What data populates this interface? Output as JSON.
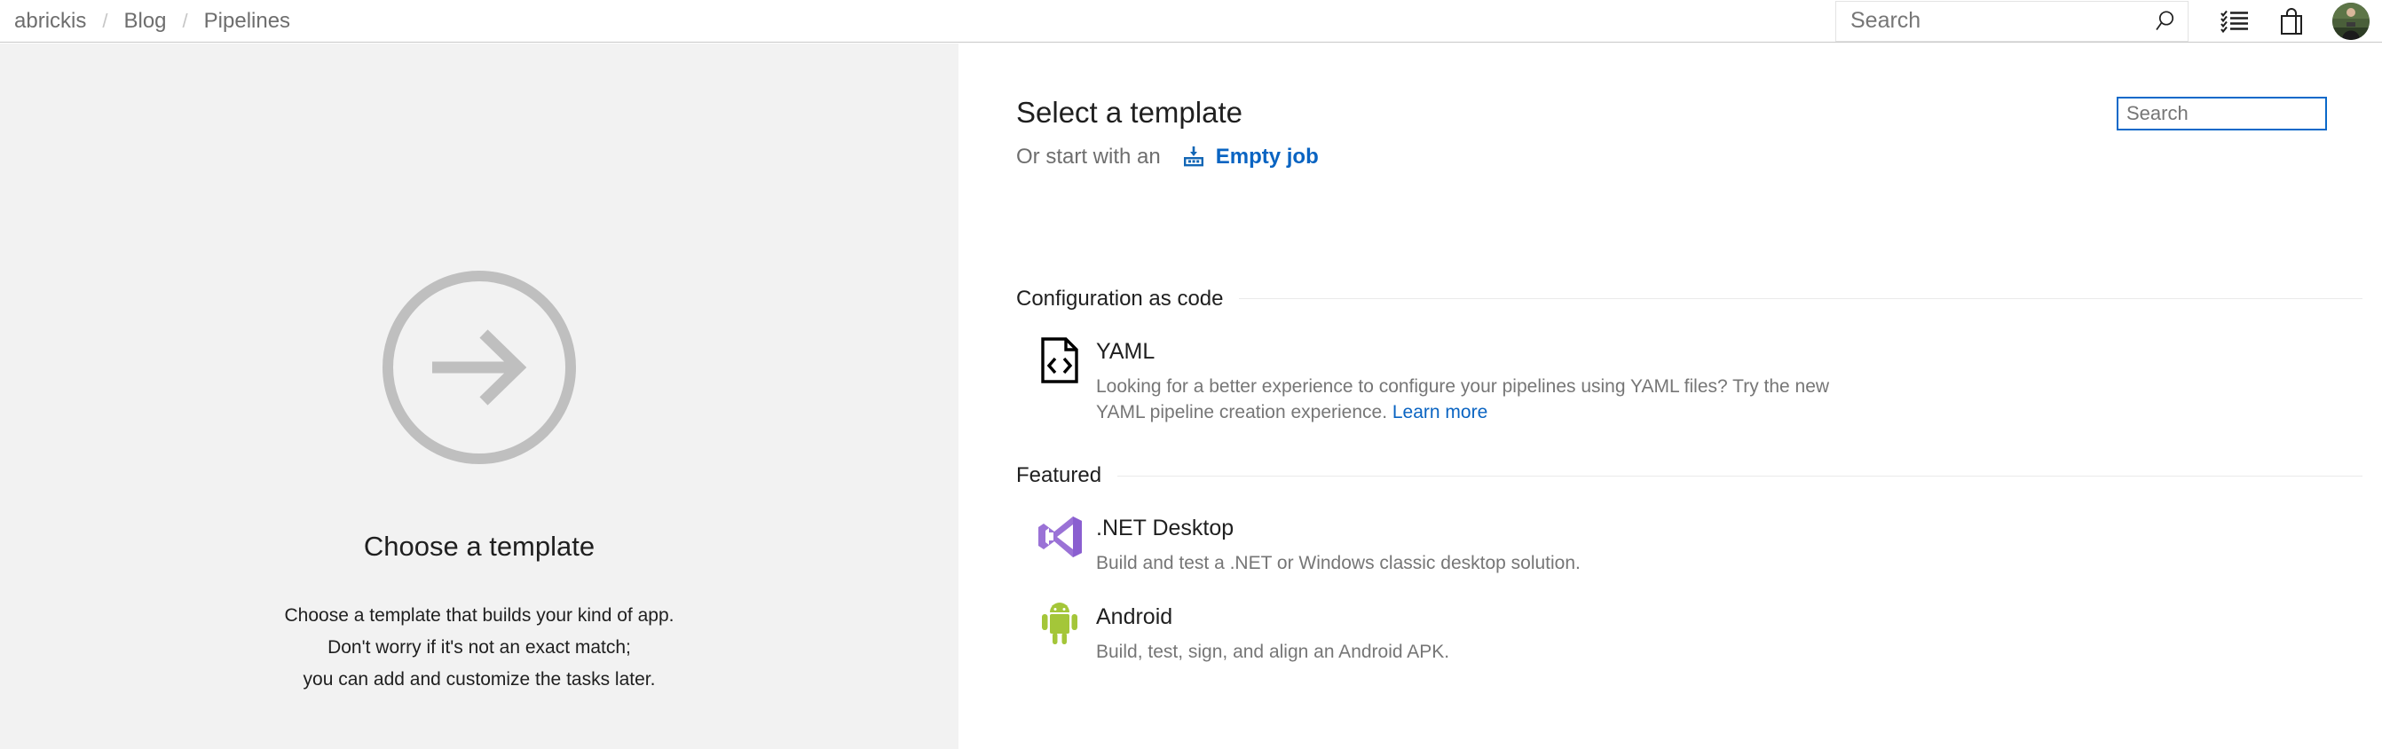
{
  "header": {
    "breadcrumb": {
      "items": [
        "abrickis",
        "Blog",
        "Pipelines"
      ],
      "separator": "/"
    },
    "search": {
      "placeholder": "Search",
      "value": "",
      "icon": "search-icon"
    },
    "icons": [
      {
        "name": "checklist-icon",
        "label": "Work items"
      },
      {
        "name": "shopping-bag-icon",
        "label": "Marketplace"
      }
    ],
    "avatar": {
      "name": "user-avatar",
      "label": ""
    }
  },
  "left_panel": {
    "illustration_icon": "arrow-right-circle-icon",
    "title": "Choose a template",
    "description_lines": [
      "Choose a template that builds your kind of app.",
      "Don't worry if it's not an exact match;",
      "you can add and customize the tasks later."
    ]
  },
  "right_panel": {
    "title": "Select a template",
    "subtitle_prefix": "Or start with an",
    "empty_job_label": "Empty job",
    "empty_job_icon": "empty-job-icon",
    "search": {
      "placeholder": "Search",
      "value": ""
    },
    "sections": [
      {
        "id": "configuration-as-code",
        "label": "Configuration as code",
        "items": [
          {
            "id": "yaml",
            "icon": "yaml-file-code-icon",
            "name": "YAML",
            "description": "Looking for a better experience to configure your pipelines using YAML files? Try the new YAML pipeline creation experience.",
            "link_label": "Learn more"
          }
        ]
      },
      {
        "id": "featured",
        "label": "Featured",
        "items": [
          {
            "id": "net-desktop",
            "icon": "visual-studio-icon",
            "name": ".NET Desktop",
            "description": "Build and test a .NET or Windows classic desktop solution.",
            "link_label": ""
          },
          {
            "id": "android",
            "icon": "android-icon",
            "name": "Android",
            "description": "Build, test, sign, and align an Android APK.",
            "link_label": ""
          }
        ]
      }
    ]
  },
  "colors": {
    "accent_blue": "#0a64c2",
    "focus_border": "#0a69c9",
    "panel_bg": "#f2f2f2",
    "muted_text": "#767676",
    "breadcrumb_text": "#6e6e6e",
    "vs_purple": "#8a64c8",
    "android_green": "#a4c639",
    "illustration_gray": "#bfbfbf"
  }
}
